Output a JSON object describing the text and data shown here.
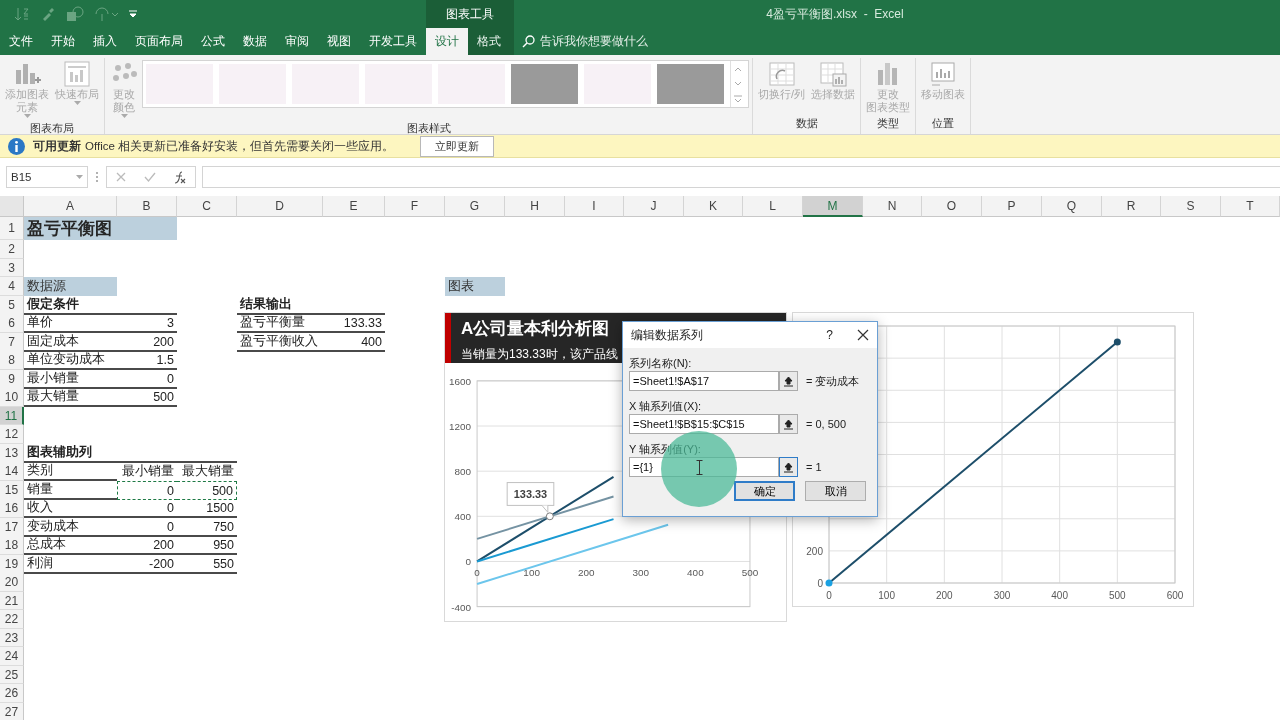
{
  "title_bar": {
    "file_title": "4盈亏平衡图.xlsx  -  Excel",
    "context_label": "图表工具"
  },
  "tabs": [
    {
      "label": "文件",
      "selected": false,
      "contextual": false
    },
    {
      "label": "开始",
      "selected": false,
      "contextual": false
    },
    {
      "label": "插入",
      "selected": false,
      "contextual": false
    },
    {
      "label": "页面布局",
      "selected": false,
      "contextual": false
    },
    {
      "label": "公式",
      "selected": false,
      "contextual": false
    },
    {
      "label": "数据",
      "selected": false,
      "contextual": false
    },
    {
      "label": "审阅",
      "selected": false,
      "contextual": false
    },
    {
      "label": "视图",
      "selected": false,
      "contextual": false
    },
    {
      "label": "开发工具",
      "selected": false,
      "contextual": false
    },
    {
      "label": "设计",
      "selected": true,
      "contextual": true
    },
    {
      "label": "格式",
      "selected": false,
      "contextual": true
    }
  ],
  "search": {
    "placeholder": "告诉我你想要做什么"
  },
  "ribbon_groups": [
    {
      "label": "图表布局",
      "commands": [
        {
          "lines": [
            "添加图表",
            "元素"
          ],
          "dropdown": true,
          "disabled": true
        },
        {
          "lines": [
            "快速布局"
          ],
          "dropdown": true,
          "disabled": true
        }
      ]
    },
    {
      "label": "图表样式",
      "commands": [
        {
          "lines": [
            "更改",
            "颜色"
          ],
          "dropdown": true,
          "disabled": true
        }
      ],
      "gallery": [
        {
          "kind": "light"
        },
        {
          "kind": "light"
        },
        {
          "kind": "light"
        },
        {
          "kind": "light"
        },
        {
          "kind": "light"
        },
        {
          "kind": "dark"
        },
        {
          "kind": "light"
        },
        {
          "kind": "dark"
        }
      ]
    },
    {
      "label": "数据",
      "commands": [
        {
          "lines": [
            "切换行/列"
          ],
          "dropdown": false,
          "disabled": true
        },
        {
          "lines": [
            "选择数据"
          ],
          "dropdown": false,
          "disabled": true
        }
      ]
    },
    {
      "label": "类型",
      "commands": [
        {
          "lines": [
            "更改",
            "图表类型"
          ],
          "dropdown": false,
          "disabled": true
        }
      ]
    },
    {
      "label": "位置",
      "commands": [
        {
          "lines": [
            "移动图表"
          ],
          "dropdown": false,
          "disabled": true
        }
      ]
    }
  ],
  "message_bar": {
    "title": "可用更新",
    "text": "Office 相关更新已准备好安装，但首先需要关闭一些应用。",
    "button": "立即更新"
  },
  "formula_bar": {
    "name_box": "B15"
  },
  "sheet": {
    "columns": [
      {
        "label": "A",
        "selected": false
      },
      {
        "label": "B",
        "selected": false
      },
      {
        "label": "C",
        "selected": false
      },
      {
        "label": "D",
        "selected": false
      },
      {
        "label": "E",
        "selected": false
      },
      {
        "label": "F",
        "selected": false
      },
      {
        "label": "G",
        "selected": false
      },
      {
        "label": "H",
        "selected": false
      },
      {
        "label": "I",
        "selected": false
      },
      {
        "label": "J",
        "selected": false
      },
      {
        "label": "K",
        "selected": false
      },
      {
        "label": "L",
        "selected": false
      },
      {
        "label": "M",
        "selected": true
      },
      {
        "label": "N",
        "selected": false
      },
      {
        "label": "O",
        "selected": false
      },
      {
        "label": "P",
        "selected": false
      },
      {
        "label": "Q",
        "selected": false
      },
      {
        "label": "R",
        "selected": false
      },
      {
        "label": "S",
        "selected": false
      },
      {
        "label": "T",
        "selected": false
      }
    ],
    "rows": [
      {
        "number": "1",
        "selected": false,
        "cells": [
          {
            "text": "盈亏平衡图",
            "kind": "title",
            "ruled": false,
            "marked": false
          },
          {
            "kind": "shaded",
            "ruled": false,
            "marked": false
          }
        ]
      },
      {
        "number": "2",
        "selected": false
      },
      {
        "number": "3",
        "selected": false
      },
      {
        "number": "4",
        "selected": false,
        "cells": [
          {
            "text": "数据源",
            "kind": "tag",
            "ruled": false,
            "marked": false
          },
          {
            "kind": "blank",
            "ruled": false,
            "marked": false
          },
          {
            "kind": "blank",
            "ruled": false,
            "marked": false
          },
          {
            "kind": "blank",
            "ruled": false,
            "marked": false
          },
          {
            "kind": "blank",
            "ruled": false,
            "marked": false
          },
          {
            "kind": "blank",
            "ruled": false,
            "marked": false
          },
          {
            "text": "图表",
            "kind": "tag",
            "ruled": false,
            "marked": false
          }
        ]
      },
      {
        "number": "5",
        "selected": false,
        "cells": [
          {
            "text": "假定条件",
            "kind": "heading",
            "ruled": true,
            "marked": false
          },
          {
            "kind": "blank",
            "ruled": true,
            "marked": false
          },
          {
            "kind": "blank",
            "ruled": false,
            "marked": false
          },
          {
            "text": "结果输出",
            "kind": "heading",
            "ruled": true,
            "marked": false
          },
          {
            "kind": "blank",
            "ruled": true,
            "marked": false
          }
        ]
      },
      {
        "number": "6",
        "selected": false,
        "cells": [
          {
            "text": "单价",
            "kind": "label",
            "ruled": true,
            "marked": false
          },
          {
            "text": "3",
            "kind": "value",
            "ruled": true,
            "marked": false
          },
          {
            "kind": "blank",
            "ruled": false,
            "marked": false
          },
          {
            "text": "盈亏平衡量",
            "kind": "label",
            "ruled": true,
            "marked": false
          },
          {
            "text": "133.33",
            "kind": "value",
            "ruled": true,
            "marked": false
          }
        ]
      },
      {
        "number": "7",
        "selected": false,
        "cells": [
          {
            "text": "固定成本",
            "kind": "label",
            "ruled": true,
            "marked": false
          },
          {
            "text": "200",
            "kind": "value",
            "ruled": true,
            "marked": false
          },
          {
            "kind": "blank",
            "ruled": false,
            "marked": false
          },
          {
            "text": "盈亏平衡收入",
            "kind": "label",
            "ruled": true,
            "marked": false
          },
          {
            "text": "400",
            "kind": "value",
            "ruled": true,
            "marked": false
          }
        ]
      },
      {
        "number": "8",
        "selected": false,
        "cells": [
          {
            "text": "单位变动成本",
            "kind": "label",
            "ruled": true,
            "marked": false
          },
          {
            "text": "1.5",
            "kind": "value",
            "ruled": true,
            "marked": false
          }
        ]
      },
      {
        "number": "9",
        "selected": false,
        "cells": [
          {
            "text": "最小销量",
            "kind": "label",
            "ruled": true,
            "marked": false
          },
          {
            "text": "0",
            "kind": "value",
            "ruled": true,
            "marked": false
          }
        ]
      },
      {
        "number": "10",
        "selected": false,
        "cells": [
          {
            "text": "最大销量",
            "kind": "label",
            "ruled": true,
            "marked": false
          },
          {
            "text": "500",
            "kind": "value",
            "ruled": true,
            "marked": false
          }
        ]
      },
      {
        "number": "11",
        "selected": true
      },
      {
        "number": "12",
        "selected": false
      },
      {
        "number": "13",
        "selected": false,
        "cells": [
          {
            "text": "图表辅助列",
            "kind": "heading",
            "ruled": true,
            "marked": false
          },
          {
            "kind": "blank",
            "ruled": true,
            "marked": false
          },
          {
            "kind": "blank",
            "ruled": true,
            "marked": false
          }
        ]
      },
      {
        "number": "14",
        "selected": false,
        "cells": [
          {
            "text": "类别",
            "kind": "label",
            "ruled": true,
            "marked": false
          },
          {
            "text": "最小销量",
            "kind": "value",
            "ruled": false,
            "marked": false
          },
          {
            "text": "最大销量",
            "kind": "value",
            "ruled": false,
            "marked": false
          }
        ]
      },
      {
        "number": "15",
        "selected": false,
        "cells": [
          {
            "text": "销量",
            "kind": "label",
            "ruled": true,
            "marked": false
          },
          {
            "text": "0",
            "kind": "value",
            "ruled": false,
            "marked": true
          },
          {
            "text": "500",
            "kind": "value",
            "ruled": false,
            "marked": true
          }
        ]
      },
      {
        "number": "16",
        "selected": false,
        "cells": [
          {
            "text": "收入",
            "kind": "label",
            "ruled": true,
            "marked": false
          },
          {
            "text": "0",
            "kind": "value",
            "ruled": true,
            "marked": false
          },
          {
            "text": "1500",
            "kind": "value",
            "ruled": true,
            "marked": false
          }
        ]
      },
      {
        "number": "17",
        "selected": false,
        "cells": [
          {
            "text": "变动成本",
            "kind": "label",
            "ruled": true,
            "marked": false
          },
          {
            "text": "0",
            "kind": "value",
            "ruled": true,
            "marked": false
          },
          {
            "text": "750",
            "kind": "value",
            "ruled": true,
            "marked": false
          }
        ]
      },
      {
        "number": "18",
        "selected": false,
        "cells": [
          {
            "text": "总成本",
            "kind": "label",
            "ruled": true,
            "marked": false
          },
          {
            "text": "200",
            "kind": "value",
            "ruled": true,
            "marked": false
          },
          {
            "text": "950",
            "kind": "value",
            "ruled": true,
            "marked": false
          }
        ]
      },
      {
        "number": "19",
        "selected": false,
        "cells": [
          {
            "text": "利润",
            "kind": "label",
            "ruled": true,
            "marked": false
          },
          {
            "text": "-200",
            "kind": "value",
            "ruled": true,
            "marked": false
          },
          {
            "text": "550",
            "kind": "value",
            "ruled": true,
            "marked": false
          }
        ]
      },
      {
        "number": "20",
        "selected": false
      },
      {
        "number": "21",
        "selected": false
      },
      {
        "number": "22",
        "selected": false
      },
      {
        "number": "23",
        "selected": false
      },
      {
        "number": "24",
        "selected": false
      },
      {
        "number": "25",
        "selected": false
      },
      {
        "number": "26",
        "selected": false
      },
      {
        "number": "27",
        "selected": false
      }
    ]
  },
  "charts": [
    {
      "title": "A公司量本利分析图",
      "subtitle": "当销量为133.33时，该产品线",
      "callout": "133.33",
      "chart_data": {
        "type": "line",
        "x": [
          0,
          250,
          350
        ],
        "series": [
          {
            "color": "#1d4e6a",
            "values": [
              0,
              750,
              null
            ]
          },
          {
            "color": "#7593a3",
            "values": [
              200,
              575,
              null
            ]
          },
          {
            "color": "#1a9ad2",
            "values": [
              0,
              375,
              null
            ]
          },
          {
            "color": "#6cc6ec",
            "values": [
              -200,
              175,
              325
            ]
          }
        ],
        "xlim": [
          0,
          500
        ],
        "ylim": [
          -400,
          1600
        ],
        "xticks": [
          0,
          100,
          200,
          300,
          400,
          500
        ],
        "yticks": [
          -400,
          0,
          400,
          800,
          1200,
          1600
        ],
        "grid": true
      }
    },
    {
      "chart_data": {
        "type": "line",
        "x": [
          0,
          500
        ],
        "series": [
          {
            "color": "#1d4e6a",
            "values": [
              0,
              1500
            ],
            "marker": true
          }
        ],
        "xlim": [
          0,
          600
        ],
        "ylim": [
          0,
          1600
        ],
        "xticks": [
          0,
          100,
          200,
          300,
          400,
          500,
          600
        ],
        "yticks": [
          0,
          200
        ],
        "grid": true
      }
    }
  ],
  "dialog": {
    "title": "编辑数据系列",
    "help": "?",
    "fields": [
      {
        "label": "系列名称(N):",
        "value": "=Sheet1!$A$17",
        "result": "= 变动成本",
        "focused": false
      },
      {
        "label": "X 轴系列值(X):",
        "value": "=Sheet1!$B$15:$C$15",
        "result": "= 0, 500",
        "focused": false
      },
      {
        "label": "Y 轴系列值(Y):",
        "value": "={1}",
        "result": "= 1",
        "focused": true
      }
    ],
    "buttons": [
      {
        "label": "确定",
        "default": true
      },
      {
        "label": "取消",
        "default": false
      }
    ]
  }
}
